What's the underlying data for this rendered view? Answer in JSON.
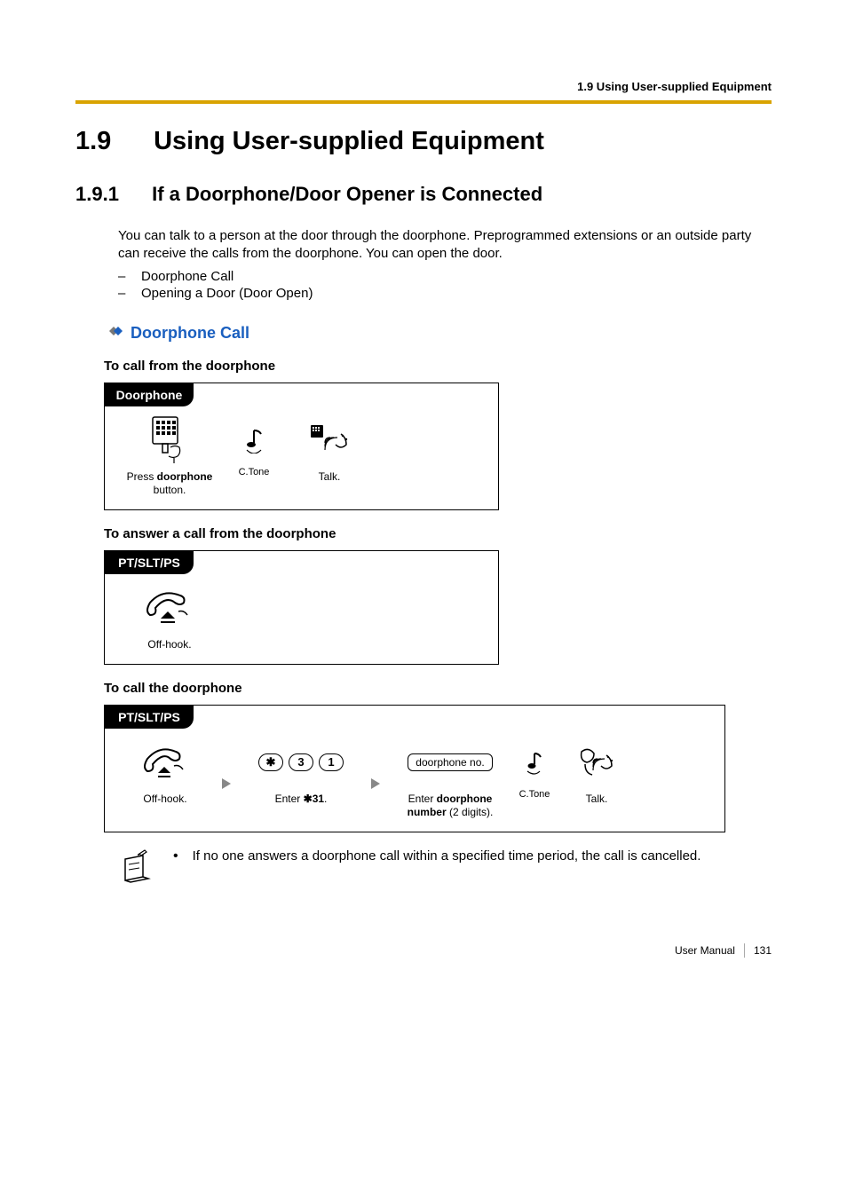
{
  "header": {
    "breadcrumb": "1.9 Using User-supplied Equipment"
  },
  "h1": {
    "num": "1.9",
    "title": "Using User-supplied Equipment"
  },
  "h2": {
    "num": "1.9.1",
    "title": "If a Doorphone/Door Opener is Connected"
  },
  "intro": {
    "p1": "You can talk to a person at the door through the doorphone. Preprogrammed extensions or an outside party can receive the calls from the doorphone. You can open the door.",
    "item1": "Doorphone Call",
    "item2": "Opening a Door (Door Open)"
  },
  "sub1": {
    "title": "Doorphone Call"
  },
  "labels": {
    "callFromDoorphone": "To call from the doorphone",
    "answerFromDoorphone": "To answer a call from the doorphone",
    "callTheDoorphone": "To call the doorphone"
  },
  "diag1": {
    "tab": "Doorphone",
    "step1a": "Press ",
    "step1b": "doorphone",
    "step1c": " button.",
    "ctone": "C.Tone",
    "talk": "Talk."
  },
  "diag2": {
    "tab": "PT/SLT/PS",
    "offhook": "Off-hook."
  },
  "diag3": {
    "tab": "PT/SLT/PS",
    "offhook": "Off-hook.",
    "keys": {
      "star": "✱",
      "d3": "3",
      "d1": "1"
    },
    "enter31a": "Enter ",
    "enter31b": "31",
    "enter31c": ".",
    "dpno": "doorphone no.",
    "dpnum1": "Enter ",
    "dpnum2": "doorphone number",
    "dpnum3": " (2 digits).",
    "ctone": "C.Tone",
    "talk": "Talk."
  },
  "note": {
    "text": "If no one answers a doorphone call within a specified time period, the call is cancelled."
  },
  "footer": {
    "manual": "User Manual",
    "page": "131"
  }
}
